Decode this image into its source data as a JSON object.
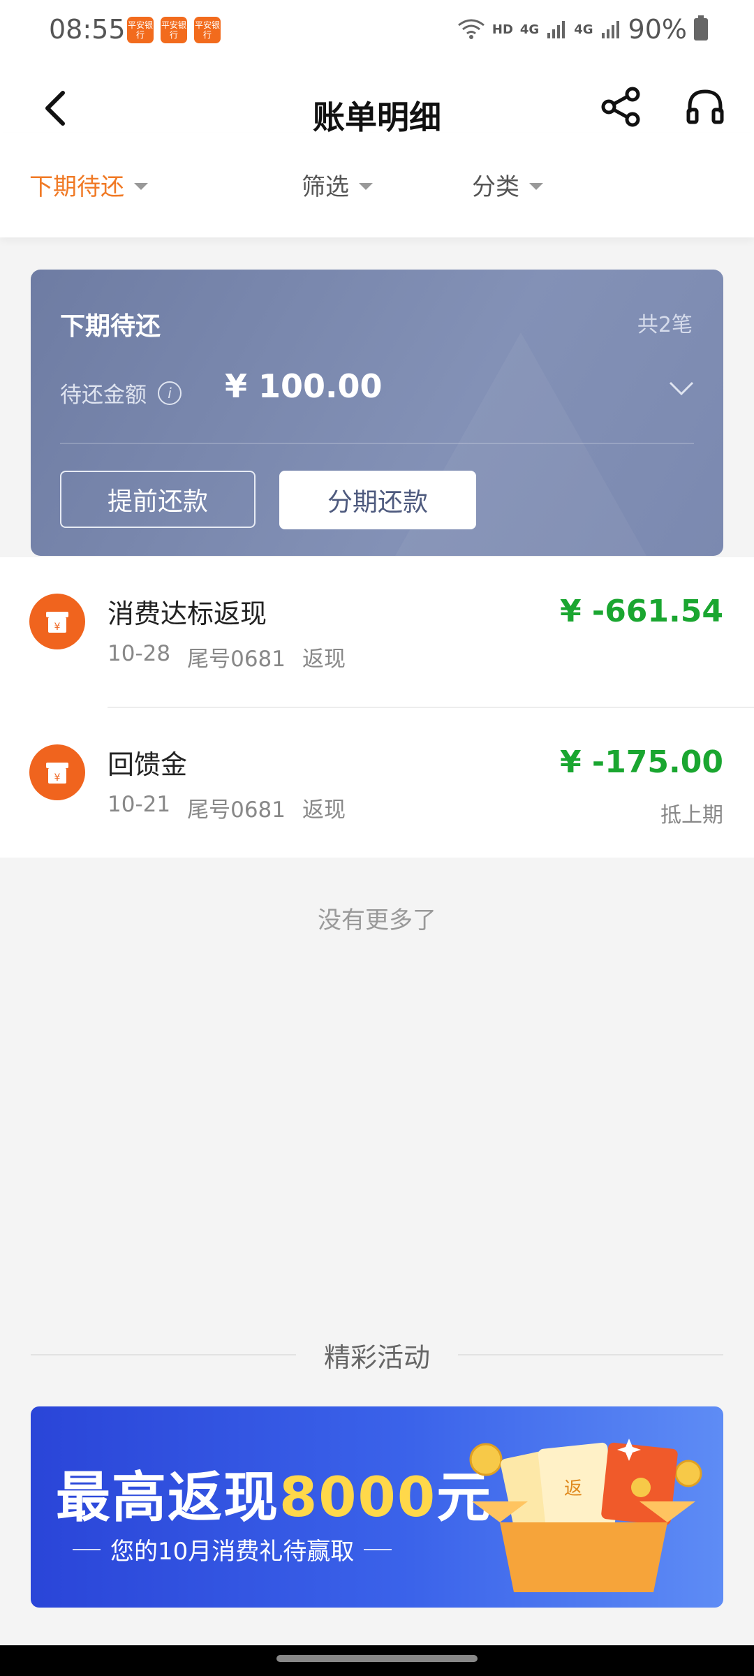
{
  "status": {
    "time": "08:55",
    "network_hd": "HD",
    "network_4g_a": "4G",
    "network_4g_b": "4G",
    "battery": "90%",
    "app_badge_text": "平安银行"
  },
  "header": {
    "title": "账单明细",
    "icons": [
      "back-icon",
      "share-icon",
      "headset-icon"
    ]
  },
  "filters": [
    {
      "label": "下期待还",
      "active": true
    },
    {
      "label": "筛选",
      "active": false
    },
    {
      "label": "分类",
      "active": false
    }
  ],
  "summary": {
    "title": "下期待还",
    "count": "共2笔",
    "amount_label": "待还金额",
    "amount": "¥ 100.00",
    "btn_prepay": "提前还款",
    "btn_installment": "分期还款"
  },
  "transactions": [
    {
      "name": "消费达标返现",
      "date": "10-28",
      "card": "尾号0681",
      "type": "返现",
      "amount": "¥ -661.54",
      "note": ""
    },
    {
      "name": "回馈金",
      "date": "10-21",
      "card": "尾号0681",
      "type": "返现",
      "amount": "¥ -175.00",
      "note": "抵上期"
    }
  ],
  "no_more": "没有更多了",
  "activities": {
    "title": "精彩活动",
    "banner_prefix": "最高返现",
    "banner_highlight": "8000",
    "banner_suffix": "元",
    "banner_sub": "您的10月消费礼待赢取",
    "art_label": "返"
  },
  "colors": {
    "accent": "#f07a26",
    "card_bg": "#7b89b0",
    "amount_green": "#1aa630",
    "icon_orange": "#f0641e",
    "banner_blue": "#2a45d8"
  }
}
